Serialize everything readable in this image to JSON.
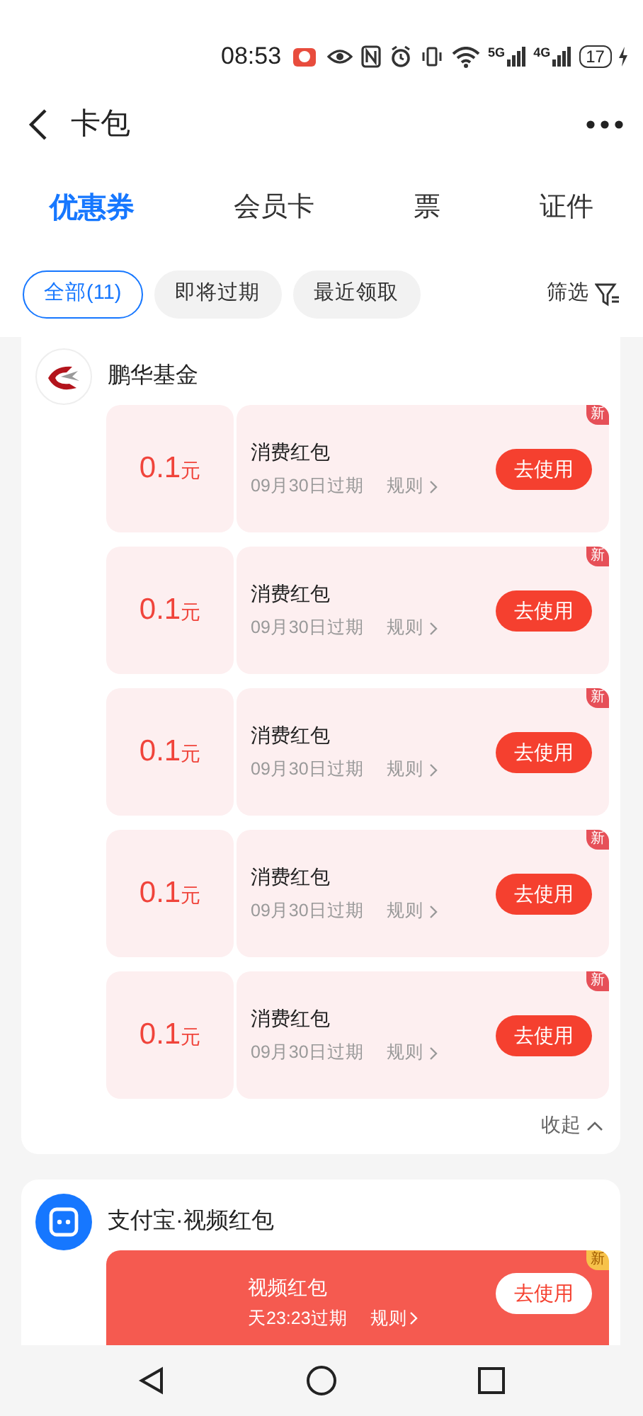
{
  "status_bar": {
    "time": "08:53",
    "signals": [
      {
        "label": "5G"
      },
      {
        "label": "4G"
      }
    ],
    "battery": "17"
  },
  "header": {
    "title": "卡包"
  },
  "tabs": [
    {
      "label": "优惠券",
      "selected": true
    },
    {
      "label": "会员卡",
      "selected": false
    },
    {
      "label": "票",
      "selected": false
    },
    {
      "label": "证件",
      "selected": false
    }
  ],
  "filters": [
    {
      "label": "全部(11)",
      "selected": true
    },
    {
      "label": "即将过期",
      "selected": false
    },
    {
      "label": "最近领取",
      "selected": false
    }
  ],
  "filter_button": "筛选",
  "groups": [
    {
      "name": "鹏华基金",
      "kind": "fund",
      "collapse": "收起",
      "coupons": [
        {
          "kind": "pale",
          "amount": "0.1",
          "unit": "元",
          "title": "消费红包",
          "expiry": "09月30日过期",
          "rules": "规则",
          "action": "去使用",
          "badge": "新"
        },
        {
          "kind": "pale",
          "amount": "0.1",
          "unit": "元",
          "title": "消费红包",
          "expiry": "09月30日过期",
          "rules": "规则",
          "action": "去使用",
          "badge": "新"
        },
        {
          "kind": "pale",
          "amount": "0.1",
          "unit": "元",
          "title": "消费红包",
          "expiry": "09月30日过期",
          "rules": "规则",
          "action": "去使用",
          "badge": "新"
        },
        {
          "kind": "pale",
          "amount": "0.1",
          "unit": "元",
          "title": "消费红包",
          "expiry": "09月30日过期",
          "rules": "规则",
          "action": "去使用",
          "badge": "新"
        },
        {
          "kind": "pale",
          "amount": "0.1",
          "unit": "元",
          "title": "消费红包",
          "expiry": "09月30日过期",
          "rules": "规则",
          "action": "去使用",
          "badge": "新"
        }
      ]
    },
    {
      "name": "支付宝·视频红包",
      "kind": "video",
      "coupons": [
        {
          "kind": "bold",
          "title": "视频红包",
          "expiry": "天23:23过期",
          "rules": "规则",
          "action": "去使用",
          "badge": "新"
        }
      ]
    }
  ]
}
